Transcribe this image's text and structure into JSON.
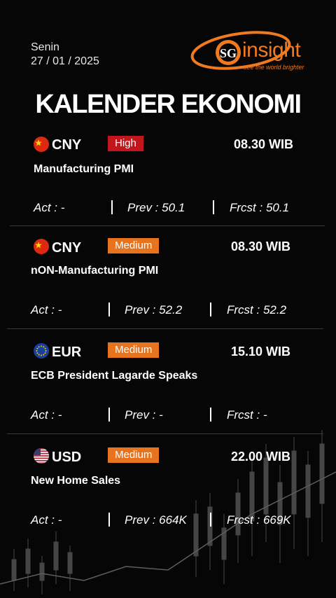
{
  "header": {
    "day": "Senin",
    "date": "27 / 01 / 2025",
    "logo_initials": "SG",
    "logo_name": "insight",
    "logo_tagline": "see the world brighter"
  },
  "title": "KALENDER EKONOMI",
  "colors": {
    "accent": "#f07a1f",
    "high_badge": "#c3151c",
    "medium_badge": "#e8731f",
    "background": "#060606"
  },
  "events": [
    {
      "flag_icon": "china-flag-icon",
      "currency": "CNY",
      "impact": "High",
      "time": "08.30 WIB",
      "name": "Manufacturing PMI",
      "act": "Act : -",
      "prev": "Prev : 50.1",
      "frcst": "Frcst : 50.1"
    },
    {
      "flag_icon": "china-flag-icon",
      "currency": "CNY",
      "impact": "Medium",
      "time": "08.30 WIB",
      "name": "nON-Manufacturing PMI",
      "act": "Act : -",
      "prev": "Prev : 52.2",
      "frcst": "Frcst : 52.2"
    },
    {
      "flag_icon": "eu-flag-icon",
      "currency": "EUR",
      "impact": "Medium",
      "time": "15.10 WIB",
      "name": "ECB President Lagarde Speaks",
      "act": "Act : -",
      "prev": "Prev : -",
      "frcst": "Frcst : -"
    },
    {
      "flag_icon": "us-flag-icon",
      "currency": "USD",
      "impact": "Medium",
      "time": "22.00 WIB",
      "name": "New Home Sales",
      "act": "Act : -",
      "prev": "Prev : 664K",
      "frcst": "Frcst : 669K"
    }
  ]
}
